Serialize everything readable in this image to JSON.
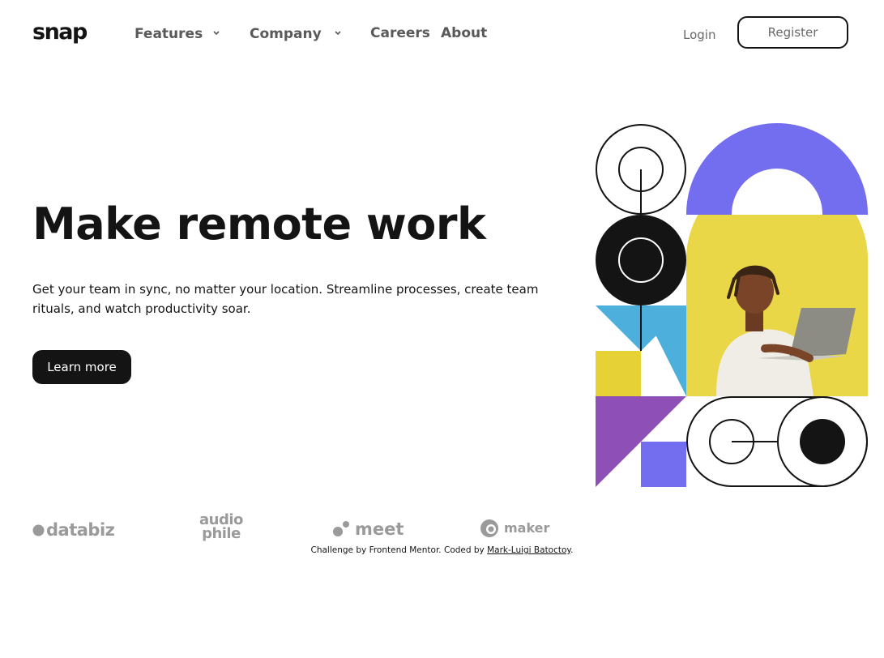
{
  "brand": {
    "logo": "snap"
  },
  "nav": {
    "items": [
      {
        "label": "Features",
        "dropdown": true
      },
      {
        "label": "Company",
        "dropdown": true
      },
      {
        "label": "Careers"
      },
      {
        "label": "About"
      }
    ],
    "login": "Login",
    "register": "Register"
  },
  "hero": {
    "title": "Make remote work",
    "text": "Get your team in sync, no matter your location. Streamline processes, create team rituals, and watch productivity soar.",
    "cta": "Learn more"
  },
  "clients": [
    {
      "name": "databiz",
      "icon": "dot-icon"
    },
    {
      "name": "audio phile",
      "line1": "audio",
      "line2": "phile"
    },
    {
      "name": "meet",
      "icon": "dots-icon"
    },
    {
      "name": "maker",
      "icon": "maker-circle-icon"
    }
  ],
  "footer": {
    "prefix": "Challenge by Frontend Mentor. Coded by ",
    "author": "Mark-Luigi Batoctoy",
    "suffix": "."
  },
  "colors": {
    "text": "#141414",
    "muted": "#696969",
    "purple": "#736DEF",
    "yellow": "#E6D236",
    "blue": "#4DB0DC",
    "violet": "#8E4FB6",
    "client_gray": "#9A9A9A"
  },
  "hero_image": "man-with-laptop-photo"
}
